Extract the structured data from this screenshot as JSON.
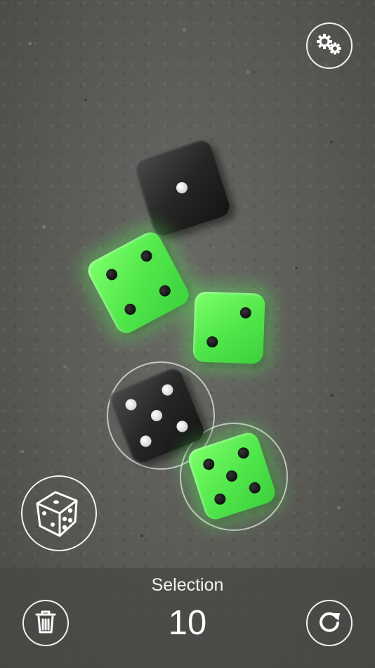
{
  "app": {
    "table_color": "#5a5955",
    "dice_colors": {
      "unselected": "#262626",
      "selected": "#4fe64a"
    }
  },
  "dice": [
    {
      "value": 1,
      "color": "black",
      "selected": false,
      "highlighted": false
    },
    {
      "value": 4,
      "color": "green",
      "selected": true,
      "highlighted": false
    },
    {
      "value": 2,
      "color": "green",
      "selected": true,
      "highlighted": false
    },
    {
      "value": 5,
      "color": "black",
      "selected": false,
      "highlighted": true
    },
    {
      "value": 5,
      "color": "green",
      "selected": true,
      "highlighted": true
    }
  ],
  "bottom_bar": {
    "selection_label": "Selection",
    "selection_total": "10"
  },
  "icons": {
    "settings": "gears-icon",
    "new_roll": "dice-icon",
    "clear": "trash-icon",
    "reroll": "refresh-icon"
  }
}
